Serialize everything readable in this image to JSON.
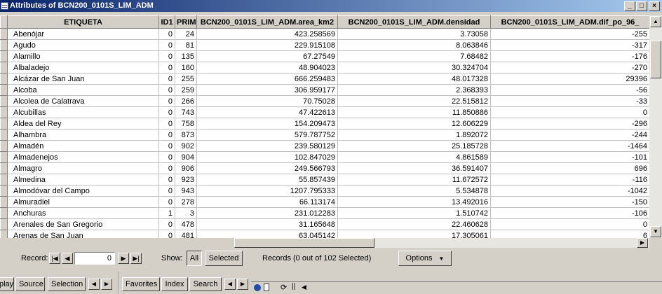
{
  "window": {
    "title": "Attributes of BCN200_0101S_LIM_ADM",
    "minimize": "_",
    "maximize": "□",
    "close": "×"
  },
  "table": {
    "columns": [
      "ETIQUETA",
      "ID1",
      "PRIM",
      "BCN200_0101S_LIM_ADM.area_km2",
      "BCN200_0101S_LIM_ADM.densidad",
      "BCN200_0101S_LIM_ADM.dif_po_96_"
    ],
    "rows": [
      [
        "Abenójar",
        "0",
        "24",
        "423.258569",
        "3.73058",
        "-255"
      ],
      [
        "Agudo",
        "0",
        "81",
        "229.915108",
        "8.063846",
        "-317"
      ],
      [
        "Alamillo",
        "0",
        "135",
        "67.27549",
        "7.68482",
        "-176"
      ],
      [
        "Albaladejo",
        "0",
        "160",
        "48.904023",
        "30.324704",
        "-270"
      ],
      [
        "Alcázar de San Juan",
        "0",
        "255",
        "666.259483",
        "48.017328",
        "29396"
      ],
      [
        "Alcoba",
        "0",
        "259",
        "306.959177",
        "2.368393",
        "-56"
      ],
      [
        "Alcolea de Calatrava",
        "0",
        "266",
        "70.75028",
        "22.515812",
        "-33"
      ],
      [
        "Alcubillas",
        "0",
        "743",
        "47.422613",
        "11.850886",
        "0"
      ],
      [
        "Aldea del Rey",
        "0",
        "758",
        "154.209473",
        "12.606229",
        "-296"
      ],
      [
        "Alhambra",
        "0",
        "873",
        "579.787752",
        "1.892072",
        "-244"
      ],
      [
        "Almadén",
        "0",
        "902",
        "239.580129",
        "25.185728",
        "-1464"
      ],
      [
        "Almadenejos",
        "0",
        "904",
        "102.847029",
        "4.861589",
        "-101"
      ],
      [
        "Almagro",
        "0",
        "906",
        "249.566793",
        "36.591407",
        "696"
      ],
      [
        "Almedina",
        "0",
        "923",
        "55.857439",
        "11.672572",
        "-116"
      ],
      [
        "Almodóvar del Campo",
        "0",
        "943",
        "1207.795333",
        "5.534878",
        "-1042"
      ],
      [
        "Almuradiel",
        "0",
        "278",
        "66.113174",
        "13.492016",
        "-150"
      ],
      [
        "Anchuras",
        "1",
        "3",
        "231.012283",
        "1.510742",
        "-106"
      ],
      [
        "Arenales de San Gregorio",
        "0",
        "478",
        "31.165648",
        "22.460628",
        "0"
      ],
      [
        "Arenas de San Juan",
        "0",
        "481",
        "63.045142",
        "17.305061",
        "6"
      ]
    ]
  },
  "recordbar": {
    "record_label": "Record:",
    "record_value": "0",
    "show_label": "Show:",
    "all_label": "All",
    "selected_label": "Selected",
    "records_status": "Records (0 out of 102 Selected)",
    "options_label": "Options"
  },
  "bottom_tabs": {
    "left": [
      "play",
      "Source",
      "Selection"
    ],
    "right": [
      "Favorites",
      "Index",
      "Search"
    ]
  }
}
